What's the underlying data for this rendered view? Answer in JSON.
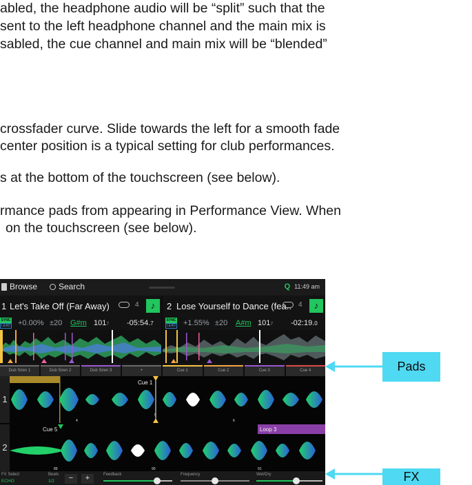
{
  "document": {
    "paragraphs": [
      "abled, the headphone audio will be “split” such that the",
      "sent to the left headphone channel and the main mix is",
      "sabled, the cue channel and main mix will be “blended”",
      "crossfader curve. Slide towards the left for a smooth fade",
      "center position is a typical setting for club performances.",
      "s at the bottom of the touchscreen (see below).",
      "rmance pads from appearing in Performance View. When",
      "on the touchscreen (see below)."
    ],
    "callouts": {
      "pads": "Pads",
      "fx": "FX"
    }
  },
  "device": {
    "topbar": {
      "browse": "Browse",
      "search": "Search",
      "q": "Q",
      "time": "11:49 am"
    },
    "deck1": {
      "number": "1",
      "title": "Let's Take Off (Far Away)",
      "loop": "4",
      "pitch": "+0.00%",
      "range": "±20",
      "key": "G#m",
      "bpm": "101",
      "bpm_dec": "7",
      "time": "-05:54.",
      "time_dec": "7",
      "sync": "SYNC",
      "lead": "LEAD",
      "pads": [
        "Dub Siren 1",
        "Dub Siren 2",
        "Dub Siren 3",
        "+"
      ]
    },
    "deck2": {
      "number": "2",
      "title": "Lose Yourself to Dance (fea...",
      "loop": "4",
      "pitch": "+1.55%",
      "range": "±20",
      "key": "A#m",
      "bpm": "101",
      "bpm_dec": "7",
      "time": "-02:19.",
      "time_dec": "0",
      "sync": "SYNC",
      "lead": "LEAD",
      "pads": [
        "Cue 1",
        "Cue 2",
        "Cue 3",
        "Cue 4"
      ]
    },
    "waveform": {
      "cue1": "Cue 1",
      "cue5": "Cue 5",
      "loop3": "Loop 3",
      "beats_top": [
        "4",
        "5",
        "6"
      ],
      "beats_bottom": [
        "89",
        "90",
        "91"
      ],
      "side1": "1",
      "side2": "2"
    },
    "fx": {
      "select_label": "FX Select",
      "select_value": "ECHO",
      "beats_label": "Beats",
      "beats_value": "1/2",
      "minus": "−",
      "plus": "+",
      "feedback": "Feedback",
      "frequency": "Frequency",
      "wetdry": "Wet/Dry",
      "feedback_level": 0.78,
      "frequency_level": 0.5,
      "wetdry_level": 0.6
    }
  }
}
